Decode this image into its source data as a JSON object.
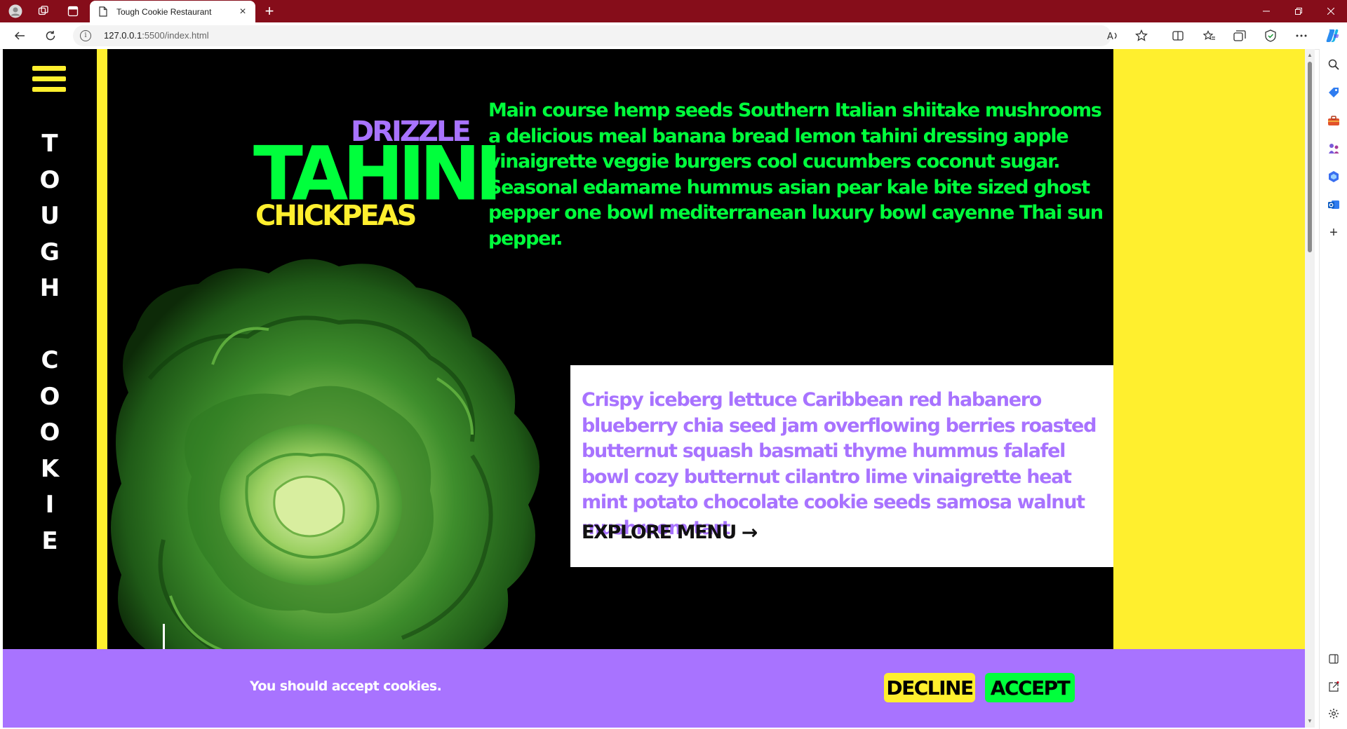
{
  "browser": {
    "tab_title": "Tough Cookie Restaurant",
    "new_tab_symbol": "+",
    "close_symbol": "×",
    "url_host": "127.0.0.1",
    "url_rest": ":5500/index.html",
    "accent": "#860d1a"
  },
  "nav": {
    "logo_letters": [
      "T",
      "O",
      "U",
      "G",
      "H",
      " ",
      "C",
      "O",
      "O",
      "K",
      "I",
      "E"
    ]
  },
  "hero": {
    "stack": {
      "drizzle": "DRIZZLE",
      "tahini": "TAHINI",
      "chickpeas": "CHICKPEAS"
    },
    "intro": "Main course hemp seeds Southern Italian shiitake mushrooms a delicious meal banana bread lemon tahini dressing apple vinaigrette veggie burgers cool cucumbers coconut sugar. Seasonal edamame hummus asian pear kale bite sized ghost pepper one bowl mediterranean luxury bowl cayenne Thai sun pepper.",
    "card_text": "Crispy iceberg lettuce Caribbean red habanero blueberry chia seed jam overflowing berries roasted butternut squash basmati thyme hummus falafel bowl cozy butternut cilantro lime vinaigrette heat mint potato chocolate cookie seeds samosa walnut mushroom tart.",
    "cta_label": "EXPLORE MENU",
    "cta_arrow": "→"
  },
  "cookie_banner": {
    "message": "You should accept cookies.",
    "decline_label": "DECLINE",
    "accept_label": "ACCEPT"
  },
  "colors": {
    "yellow": "#ffef2e",
    "green": "#00ff3c",
    "purple": "#a873ff",
    "black": "#000000"
  }
}
